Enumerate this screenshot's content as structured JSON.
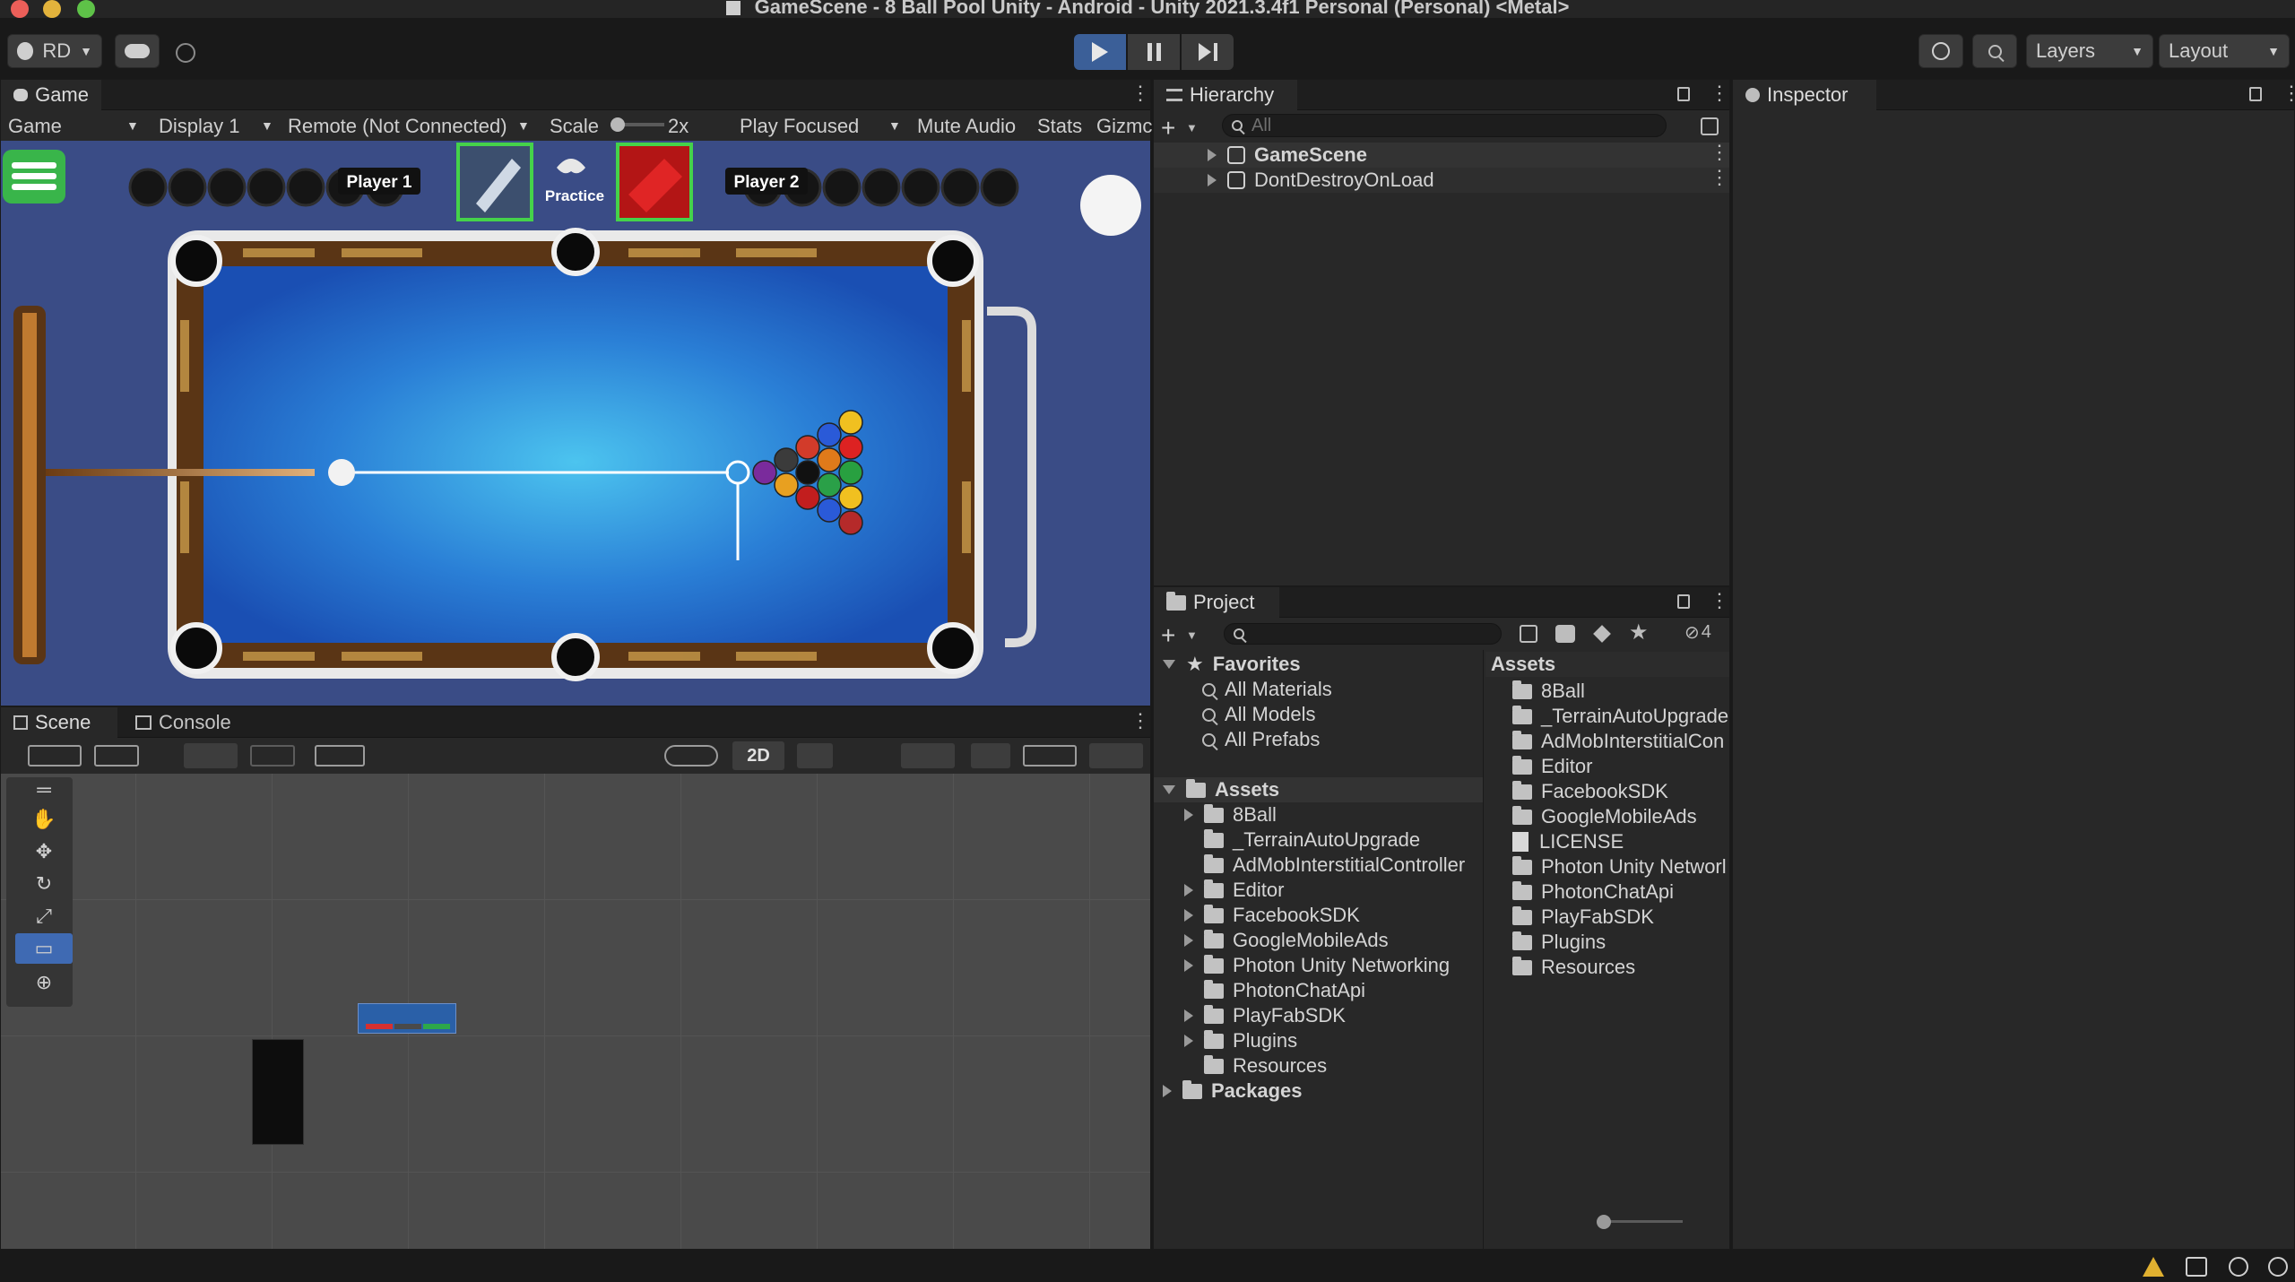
{
  "window": {
    "title": "GameScene - 8 Ball Pool Unity - Android - Unity 2021.3.4f1 Personal (Personal) <Metal>"
  },
  "toolbar": {
    "account": "RD",
    "layers": "Layers",
    "layout": "Layout"
  },
  "game_panel": {
    "tab": "Game",
    "view_mode": "Game",
    "display": "Display 1",
    "remote": "Remote (Not Connected)",
    "scale_label": "Scale",
    "scale_value": "2x",
    "play_focused": "Play Focused",
    "mute_audio": "Mute Audio",
    "stats": "Stats",
    "gizmos": "Gizmc",
    "game": {
      "player1": "Player 1",
      "player2": "Player 2",
      "practice": "Practice"
    }
  },
  "scene_panel": {
    "tabs": [
      "Scene",
      "Console"
    ],
    "btn_2d": "2D"
  },
  "hierarchy": {
    "tab": "Hierarchy",
    "search_placeholder": "All",
    "items": [
      "GameScene",
      "DontDestroyOnLoad"
    ]
  },
  "inspector": {
    "tab": "Inspector"
  },
  "project": {
    "tab": "Project",
    "hidden_count": "4",
    "favorites_label": "Favorites",
    "favorites": [
      "All Materials",
      "All Models",
      "All Prefabs"
    ],
    "assets_label": "Assets",
    "tree": [
      {
        "label": "8Ball",
        "expandable": true
      },
      {
        "label": "_TerrainAutoUpgrade",
        "expandable": false
      },
      {
        "label": "AdMobInterstitialController",
        "expandable": false
      },
      {
        "label": "Editor",
        "expandable": true
      },
      {
        "label": "FacebookSDK",
        "expandable": true
      },
      {
        "label": "GoogleMobileAds",
        "expandable": true
      },
      {
        "label": "Photon Unity Networking",
        "expandable": true
      },
      {
        "label": "PhotonChatApi",
        "expandable": false
      },
      {
        "label": "PlayFabSDK",
        "expandable": true
      },
      {
        "label": "Plugins",
        "expandable": true
      },
      {
        "label": "Resources",
        "expandable": false
      }
    ],
    "packages_label": "Packages",
    "content_header": "Assets",
    "content": [
      {
        "label": "8Ball",
        "kind": "folder"
      },
      {
        "label": "_TerrainAutoUpgrade",
        "kind": "folder"
      },
      {
        "label": "AdMobInterstitialCon",
        "kind": "folder"
      },
      {
        "label": "Editor",
        "kind": "folder"
      },
      {
        "label": "FacebookSDK",
        "kind": "folder"
      },
      {
        "label": "GoogleMobileAds",
        "kind": "folder"
      },
      {
        "label": "LICENSE",
        "kind": "file"
      },
      {
        "label": "Photon Unity Networl",
        "kind": "folder"
      },
      {
        "label": "PhotonChatApi",
        "kind": "folder"
      },
      {
        "label": "PlayFabSDK",
        "kind": "folder"
      },
      {
        "label": "Plugins",
        "kind": "folder"
      },
      {
        "label": "Resources",
        "kind": "folder"
      }
    ]
  },
  "colors": {
    "accent": "#3f6ab3",
    "play_active": "#3b5f98",
    "felt": "#2f8de0",
    "rail": "#5a3515",
    "game_bg": "#3a4c86"
  }
}
